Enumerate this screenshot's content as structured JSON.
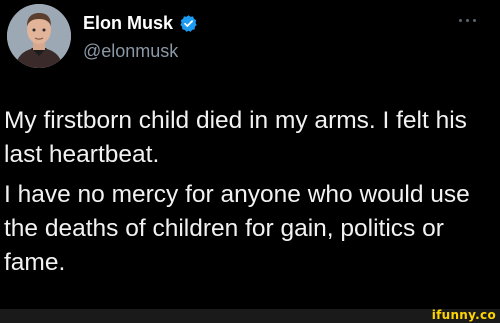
{
  "author": {
    "display_name": "Elon Musk",
    "handle": "@elonmusk",
    "verified_badge_icon": "verified-badge-icon",
    "avatar_icon": "profile-avatar"
  },
  "menu": {
    "icon": "more-options-icon"
  },
  "tweet": {
    "paragraphs": [
      "My firstborn child died in my arms. I felt his last heartbeat.",
      "I have no mercy for anyone who would use the deaths of children for gain, politics or fame."
    ]
  },
  "watermark": {
    "text": "ifunny.co"
  },
  "colors": {
    "background": "#000000",
    "text": "#e7e9ea",
    "secondary_text": "#8b98a5",
    "verified_blue": "#1d9bf0",
    "watermark": "#ffd500"
  }
}
